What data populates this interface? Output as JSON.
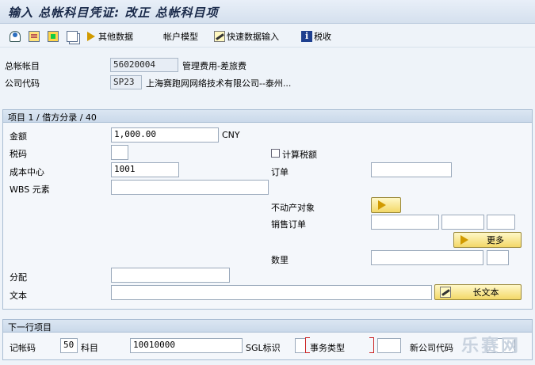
{
  "window": {
    "title": "输入 总帐科目凭证: 改正 总帐科目项"
  },
  "toolbar": {
    "other_data": "其他数据",
    "account_model": "帐户模型",
    "fast_entry": "快速数据输入",
    "tax": "税收"
  },
  "header": {
    "gl_account_label": "总帐帐目",
    "gl_account_value": "56020004",
    "gl_account_desc": "管理费用-差旅费",
    "company_code_label": "公司代码",
    "company_code_value": "SP23",
    "company_code_desc": "上海赛跑网网络技术有限公司--泰州..."
  },
  "item": {
    "section_title": "项目 1 / 借方分录 / 40",
    "amount_label": "金额",
    "amount_value": "1,000.00",
    "currency": "CNY",
    "tax_code_label": "税码",
    "tax_code_value": "",
    "calc_tax_label": "计算税额",
    "cost_center_label": "成本中心",
    "cost_center_value": "1001",
    "order_label": "订单",
    "order_value": "",
    "wbs_label": "WBS 元素",
    "wbs_value": "",
    "real_estate_label": "不动产对象",
    "sales_order_label": "销售订单",
    "more_button": "更多",
    "quantity_label": "数里",
    "assignment_label": "分配",
    "assignment_value": "",
    "text_label": "文本",
    "text_value": "",
    "long_text_button": "长文本"
  },
  "next_item": {
    "section_title": "下一行项目",
    "posting_key_label": "记帐码",
    "posting_key_value": "50",
    "account_label": "科目",
    "account_value": "10010000",
    "sgl_label": "SGL标识",
    "sgl_value": "",
    "trans_type_label": "事务类型",
    "trans_type_value": "",
    "new_company_label": "新公司代码",
    "new_company_value": ""
  },
  "watermark": "乐赛网"
}
